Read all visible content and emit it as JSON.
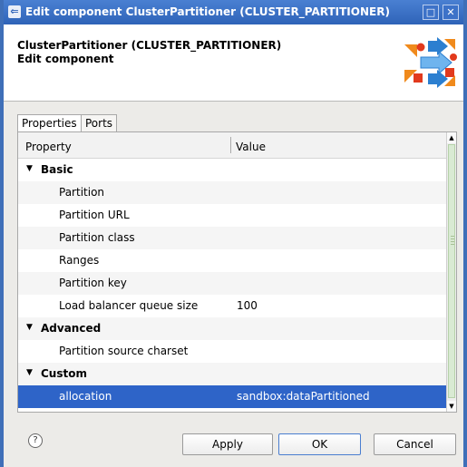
{
  "window": {
    "title": "Edit component ClusterPartitioner (CLUSTER_PARTITIONER)",
    "maximize_label": "□",
    "close_label": "✕",
    "app_icon_glyph": "⇐"
  },
  "header": {
    "title": "ClusterPartitioner (CLUSTER_PARTITIONER)",
    "subtitle": "Edit component",
    "logo_icon": "cluster-partitioner-logo-icon"
  },
  "tabs": [
    {
      "label": "Properties"
    },
    {
      "label": "Ports"
    }
  ],
  "table": {
    "col_property": "Property",
    "col_value": "Value",
    "expand_arrow": "▼",
    "rows": [
      {
        "type": "category",
        "label": "Basic"
      },
      {
        "type": "property",
        "label": "Partition",
        "value": ""
      },
      {
        "type": "property",
        "label": "Partition URL",
        "value": ""
      },
      {
        "type": "property",
        "label": "Partition class",
        "value": ""
      },
      {
        "type": "property",
        "label": "Ranges",
        "value": ""
      },
      {
        "type": "property",
        "label": "Partition key",
        "value": ""
      },
      {
        "type": "property",
        "label": "Load balancer queue size",
        "value": "100"
      },
      {
        "type": "category",
        "label": "Advanced"
      },
      {
        "type": "property",
        "label": "Partition source charset",
        "value": ""
      },
      {
        "type": "category",
        "label": "Custom"
      },
      {
        "type": "property",
        "label": "allocation",
        "value": "sandbox:dataPartitioned",
        "selected": true
      }
    ]
  },
  "scrollbar": {
    "up_glyph": "▲",
    "down_glyph": "▼"
  },
  "footer": {
    "help_glyph": "?",
    "apply_label": "Apply",
    "ok_label": "OK",
    "cancel_label": "Cancel"
  },
  "colors": {
    "titlebar": "#2f63b8",
    "selection": "#2e64c8",
    "logo_orange": "#f08a1c",
    "logo_red": "#e23a1d",
    "logo_blue": "#2c7fd0"
  }
}
